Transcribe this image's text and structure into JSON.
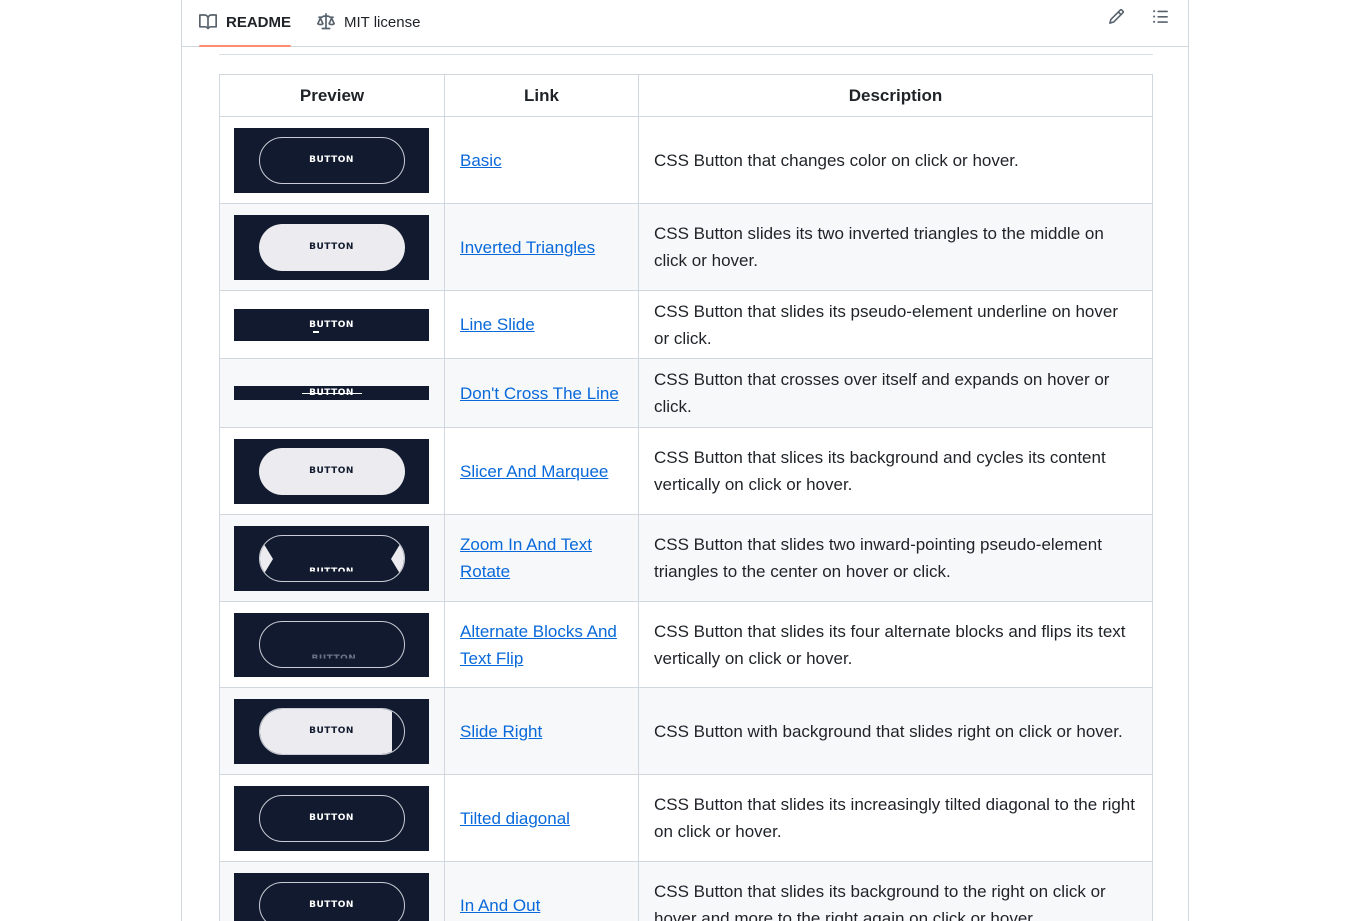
{
  "tabs": {
    "readme": "README",
    "license": "MIT license"
  },
  "table": {
    "headers": [
      "Preview",
      "Link",
      "Description"
    ],
    "button_text": "BUTTON",
    "rows": [
      {
        "link": "Basic",
        "description": "CSS Button that changes color on click or hover."
      },
      {
        "link": "Inverted Triangles",
        "description": "CSS Button slides its two inverted triangles to the middle on click or hover."
      },
      {
        "link": "Line Slide",
        "description": "CSS Button that slides its pseudo-element underline on hover or click."
      },
      {
        "link": "Don't Cross The Line",
        "description": "CSS Button that crosses over itself and expands on hover or click."
      },
      {
        "link": "Slicer And Marquee",
        "description": "CSS Button that slices its background and cycles its content vertically on click or hover."
      },
      {
        "link": "Zoom In And Text Rotate",
        "description": "CSS Button that slides two inward-pointing pseudo-element triangles to the center on hover or click."
      },
      {
        "link": "Alternate Blocks And Text Flip",
        "description": "CSS Button that slides its four alternate blocks and flips its text vertically on click or hover."
      },
      {
        "link": "Slide Right",
        "description": "CSS Button with background that slides right on click or hover."
      },
      {
        "link": "Tilted diagonal",
        "description": "CSS Button that slides its increasingly tilted diagonal to the right on click or hover."
      },
      {
        "link": "In And Out",
        "description": "CSS Button that slides its background to the right on click or hover and more to the right again on click or hover."
      }
    ]
  },
  "colors": {
    "accent_tab": "#fd8c73",
    "link": "#0969da",
    "thumb_bg": "#111a2e",
    "row_alt": "#f6f8fa"
  },
  "icons": {
    "readme": "book-icon",
    "license": "law-scale-icon",
    "edit": "pencil-icon",
    "toc": "list-icon"
  }
}
